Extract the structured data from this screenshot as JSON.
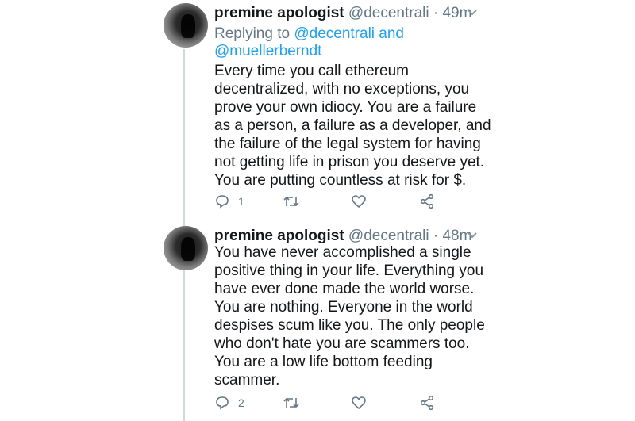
{
  "tweets": [
    {
      "name": "premine apologist",
      "handle": "@decentrali",
      "separator": "·",
      "time": "49m",
      "replying_prefix": "Replying to ",
      "replying_to_line1": "@decentrali and",
      "replying_to_line2": "@muellerberndt",
      "lines": [
        "Every time you call ethereum",
        "decentralized, with no exceptions, you",
        "prove your own idiocy. You are a failure",
        "as a person, a failure as a developer, and",
        "the failure of the legal system for having",
        "not getting life in prison you deserve yet.",
        "You are putting countless at risk for $."
      ],
      "reply_count": "1",
      "retweet_count": "",
      "like_count": ""
    },
    {
      "name": "premine apologist",
      "handle": "@decentrali",
      "separator": "·",
      "time": "48m",
      "lines": [
        "You have never accomplished a single",
        "positive thing in your life. Everything you",
        "have ever done made the world worse.",
        "You are nothing. Everyone in the world",
        "despises scum like you. The only people",
        "who don't hate you are scammers too.",
        "You are a low life bottom feeding",
        "scammer."
      ],
      "reply_count": "2",
      "retweet_count": "",
      "like_count": ""
    }
  ],
  "icons": {
    "reply": "reply-icon",
    "retweet": "retweet-icon",
    "like": "heart-icon",
    "share": "share-icon",
    "more": "chevron-down-icon"
  },
  "colors": {
    "link": "#1da1f2",
    "secondary_text": "#657786",
    "thread_line": "#cfd9de"
  }
}
